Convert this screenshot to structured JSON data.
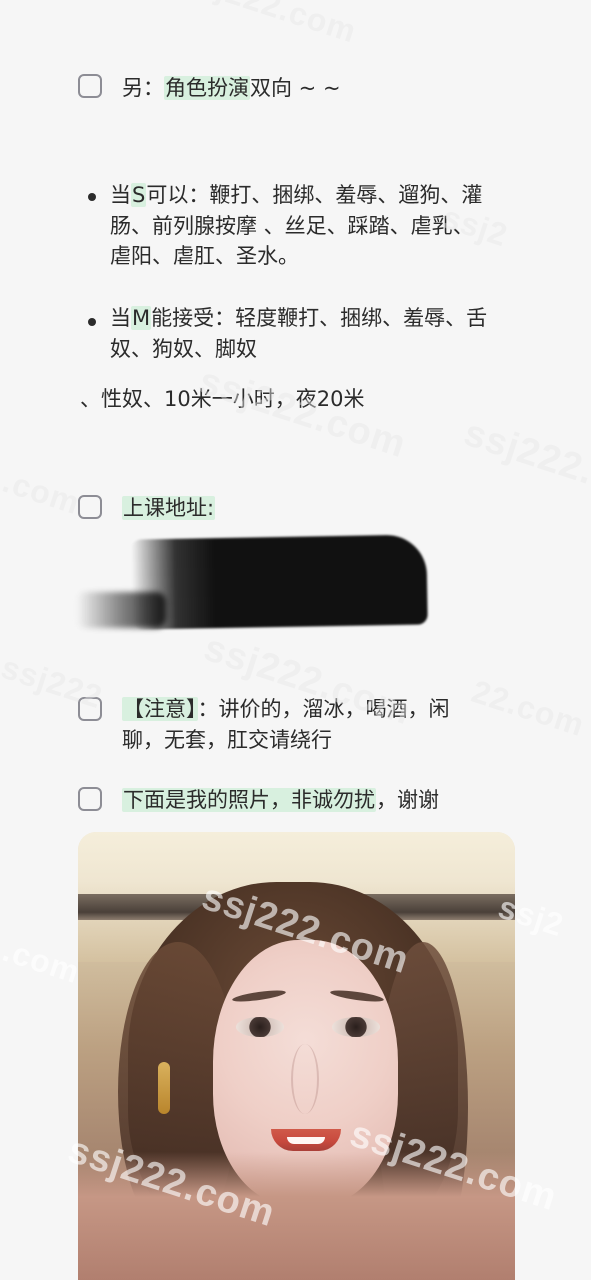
{
  "header": {
    "checkbox_1_label_prefix": "另：",
    "checkbox_1_highlight": "角色扮演",
    "checkbox_1_suffix": "双向 ~ ~"
  },
  "roles": {
    "s_prefix": "当",
    "s_highlight": "S",
    "s_line_1": "可以：鞭打、捆绑、羞辱、遛狗、灌",
    "s_line_2": "肠、前列腺按摩 、丝足、踩踏、虐乳、",
    "s_line_3": "虐阳、虐肛、圣水。",
    "m_prefix": "当",
    "m_highlight": "M",
    "m_line_1": "能接受：轻度鞭打、捆绑、羞辱、舌",
    "m_line_2": "奴、狗奴、脚奴",
    "tail_line": "、性奴、10米一小时，夜20米"
  },
  "address": {
    "label": "上课地址:"
  },
  "notes": {
    "label_highlight": "【注意】",
    "line_1_suffix": "：讲价的，溜冰，喝酒，闲",
    "line_2": "聊，无套，肛交请绕行"
  },
  "photos": {
    "label_highlight": "下面是我的照片，非诚勿扰",
    "label_suffix": "，谢谢"
  },
  "watermarks": {
    "text": "ssj222.com",
    "partial_1": "j222.com",
    "partial_2": "22.com",
    "partial_3": ".com",
    "partial_4": "ssj222",
    "partial_5": "ssj2"
  }
}
